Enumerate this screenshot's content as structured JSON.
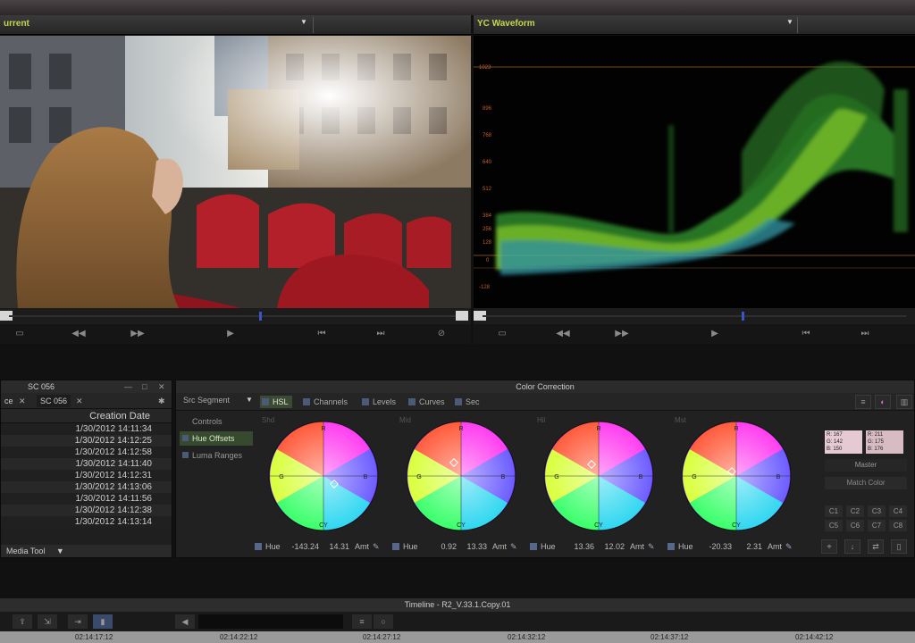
{
  "viewer": {
    "title": "urrent"
  },
  "scope": {
    "title": "YC Waveform",
    "scale": [
      "1023",
      "896",
      "768",
      "640",
      "512",
      "384",
      "256",
      "128",
      "0",
      "-128"
    ]
  },
  "bin": {
    "title": "SC 056",
    "tabs": [
      "ce",
      "SC 056"
    ],
    "column_header": "Creation Date",
    "rows": [
      "1/30/2012 14:11:34",
      "1/30/2012 14:12:25",
      "1/30/2012 14:12:58",
      "1/30/2012 14:11:40",
      "1/30/2012 14:12:31",
      "1/30/2012 14:13:06",
      "1/30/2012 14:11:56",
      "1/30/2012 14:12:38",
      "1/30/2012 14:13:14"
    ],
    "footer": "Media Tool"
  },
  "cc": {
    "title": "Color Correction",
    "segment": "Src Segment",
    "tabs": [
      "HSL",
      "Channels",
      "Levels",
      "Curves",
      "Sec"
    ],
    "side": [
      "Controls",
      "Hue Offsets",
      "Luma Ranges"
    ],
    "wheels": [
      {
        "label": "Shd",
        "hue": "Hue",
        "v1": "-143.24",
        "v2": "14.31",
        "amt": "Amt"
      },
      {
        "label": "Mid",
        "hue": "Hue",
        "v1": "0.92",
        "v2": "13.33",
        "amt": "Amt"
      },
      {
        "label": "Hil",
        "hue": "Hue",
        "v1": "13.36",
        "v2": "12.02",
        "amt": "Amt"
      },
      {
        "label": "Mst",
        "hue": "Hue",
        "v1": "-20.33",
        "v2": "2.31",
        "amt": "Amt"
      }
    ],
    "swatch_a": [
      "R: 167",
      "G: 142",
      "B: 150"
    ],
    "swatch_b": [
      "R: 211",
      "G: 175",
      "B: 176"
    ],
    "master": "Master",
    "match": "Match Color",
    "c_buttons": [
      "C1",
      "C2",
      "C3",
      "C4",
      "C5",
      "C6",
      "C7",
      "C8"
    ]
  },
  "timeline": {
    "title": "Timeline - R2_V.33.1.Copy.01",
    "ticks": [
      "02:14:17:12",
      "02:14:22:12",
      "02:14:27:12",
      "02:14:32:12",
      "02:14:37:12",
      "02:14:42:12"
    ]
  },
  "colors": {
    "accent_green": "#c7d64a",
    "playhead_blue": "#3a55c8"
  }
}
